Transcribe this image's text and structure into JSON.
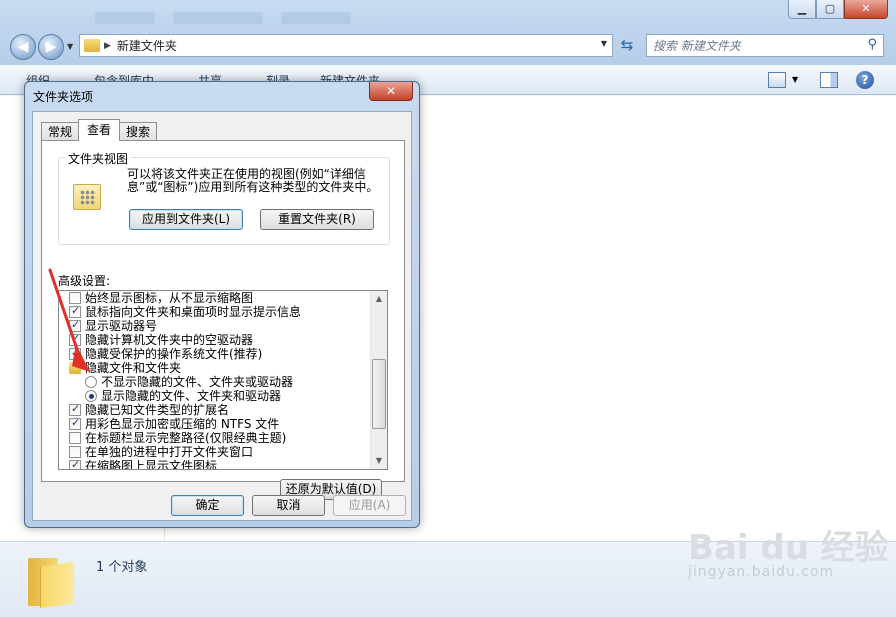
{
  "explorer": {
    "address_path": "新建文件夹",
    "search_placeholder": "搜索 新建文件夹",
    "toolbar": [
      "组织",
      "包含到库中",
      "共享",
      "刻录",
      "新建文件夹"
    ],
    "status_text": "1 个对象"
  },
  "watermark": {
    "brand": "Bai du 经验",
    "url": "jingyan.baidu.com"
  },
  "dialog": {
    "title": "文件夹选项",
    "tabs": [
      {
        "label": "常规",
        "active": false
      },
      {
        "label": "查看",
        "active": true
      },
      {
        "label": "搜索",
        "active": false
      }
    ],
    "folder_views": {
      "label": "文件夹视图",
      "description": "可以将该文件夹正在使用的视图(例如“详细信息”或“图标”)应用到所有这种类型的文件夹中。",
      "apply_button": "应用到文件夹(L)",
      "reset_button": "重置文件夹(R)"
    },
    "advanced_label": "高级设置:",
    "advanced_items": [
      {
        "type": "checkbox",
        "checked": false,
        "indent": 1,
        "label": "始终显示图标，从不显示缩略图"
      },
      {
        "type": "checkbox",
        "checked": true,
        "indent": 1,
        "label": "鼠标指向文件夹和桌面项时显示提示信息"
      },
      {
        "type": "checkbox",
        "checked": true,
        "indent": 1,
        "label": "显示驱动器号"
      },
      {
        "type": "checkbox",
        "checked": true,
        "indent": 1,
        "label": "隐藏计算机文件夹中的空驱动器"
      },
      {
        "type": "checkbox",
        "checked": true,
        "indent": 1,
        "label": "隐藏受保护的操作系统文件(推荐)"
      },
      {
        "type": "folder",
        "checked": false,
        "indent": 1,
        "label": "隐藏文件和文件夹"
      },
      {
        "type": "radio",
        "checked": false,
        "indent": 2,
        "label": "不显示隐藏的文件、文件夹或驱动器"
      },
      {
        "type": "radio",
        "checked": true,
        "indent": 2,
        "label": "显示隐藏的文件、文件夹和驱动器"
      },
      {
        "type": "checkbox",
        "checked": true,
        "indent": 1,
        "label": "隐藏已知文件类型的扩展名"
      },
      {
        "type": "checkbox",
        "checked": true,
        "indent": 1,
        "label": "用彩色显示加密或压缩的 NTFS 文件"
      },
      {
        "type": "checkbox",
        "checked": false,
        "indent": 1,
        "label": "在标题栏显示完整路径(仅限经典主题)"
      },
      {
        "type": "checkbox",
        "checked": false,
        "indent": 1,
        "label": "在单独的进程中打开文件夹窗口"
      },
      {
        "type": "checkbox",
        "checked": true,
        "indent": 1,
        "label": "在缩略图上显示文件图标"
      }
    ],
    "restore_button": "还原为默认值(D)",
    "ok_button": "确定",
    "cancel_button": "取消",
    "apply_button": "应用(A)"
  },
  "colors": {
    "annotation_arrow": "#e0302a",
    "title_bar": "#bdd3ec"
  }
}
